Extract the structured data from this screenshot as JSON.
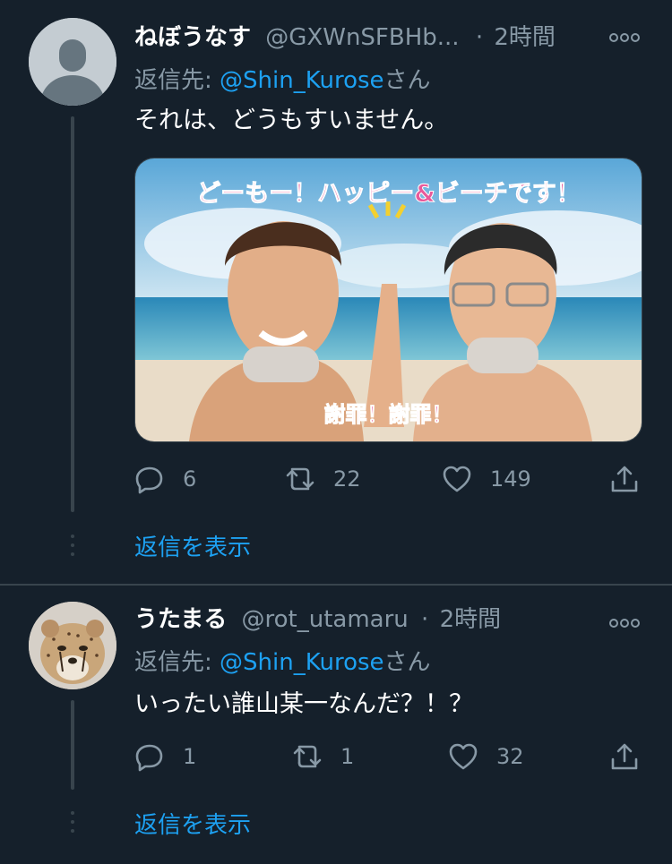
{
  "tweets": [
    {
      "name": "ねぼうなす",
      "handle": "@GXWnSFBHb...",
      "sep": "·",
      "time": "2時間",
      "replying_prefix": "返信先: ",
      "replying_to": "@Shin_Kurose",
      "replying_suffix": "さん",
      "text": "それは、どうもすいません。",
      "media_caption_top": "どーもー！ハッピー&ビーチです！",
      "media_caption_bottom": "謝罪！謝罪！",
      "counts": {
        "reply": "6",
        "retweet": "22",
        "like": "149"
      },
      "show_replies": "返信を表示"
    },
    {
      "name": "うたまる",
      "handle": "@rot_utamaru",
      "sep": "·",
      "time": "2時間",
      "replying_prefix": "返信先: ",
      "replying_to": "@Shin_Kurose",
      "replying_suffix": "さん",
      "text": "いったい誰山某一なんだ？！？",
      "counts": {
        "reply": "1",
        "retweet": "1",
        "like": "32"
      },
      "show_replies": "返信を表示"
    }
  ],
  "icons": {
    "reply": "reply-icon",
    "retweet": "retweet-icon",
    "like": "heart-icon",
    "share": "share-icon",
    "more": "more-options-icon"
  },
  "colors": {
    "background": "#15202b",
    "secondary_text": "#8899a6",
    "accent": "#1da1f2",
    "divider": "#38444d"
  }
}
